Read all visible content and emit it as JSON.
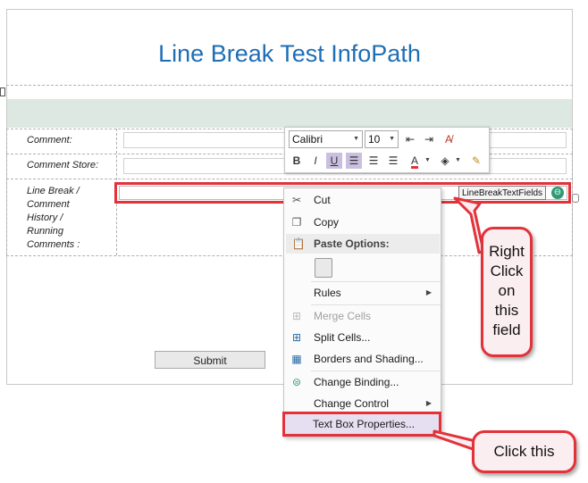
{
  "form": {
    "title": "Line Break Test InfoPath",
    "labels": {
      "comment": "Comment:",
      "comment_store": "Comment Store:",
      "line_break_lines": [
        "Line Break /",
        "Comment",
        "History /",
        "Running",
        "Comments :"
      ]
    },
    "submit_label": "Submit",
    "binding_tag": "LineBreakTextFields"
  },
  "mini_toolbar": {
    "font_name": "Calibri",
    "font_size": "10",
    "buttons": [
      "B",
      "I",
      "U"
    ]
  },
  "context_menu": {
    "items": [
      {
        "label": "Cut",
        "icon": "scissors-icon",
        "enabled": true,
        "submenu": false
      },
      {
        "label": "Copy",
        "icon": "copy-icon",
        "enabled": true,
        "submenu": false
      },
      {
        "label": "Paste Options:",
        "icon": "paste-icon",
        "enabled": true,
        "heading": true
      },
      {
        "label": "Rules",
        "enabled": true,
        "submenu": true
      },
      {
        "label": "Merge Cells",
        "icon": "merge-cells-icon",
        "enabled": false,
        "submenu": false
      },
      {
        "label": "Split Cells...",
        "icon": "split-cells-icon",
        "enabled": true,
        "submenu": false
      },
      {
        "label": "Borders and Shading...",
        "icon": "borders-icon",
        "enabled": true,
        "submenu": false
      },
      {
        "label": "Change Binding...",
        "icon": "binding-icon",
        "enabled": true,
        "submenu": false
      },
      {
        "label": "Change Control",
        "enabled": true,
        "submenu": true
      },
      {
        "label": "Text Box Properties...",
        "enabled": true,
        "submenu": false,
        "highlighted": true
      }
    ]
  },
  "callouts": {
    "right_click_lines": [
      "Right",
      "Click",
      "on",
      "this",
      "field"
    ],
    "click_this": "Click this"
  },
  "colors": {
    "title_blue": "#1e6eb5",
    "highlight_red": "#e2323a",
    "band_green": "#dde8e2",
    "menu_highlight": "#e6dff1"
  }
}
